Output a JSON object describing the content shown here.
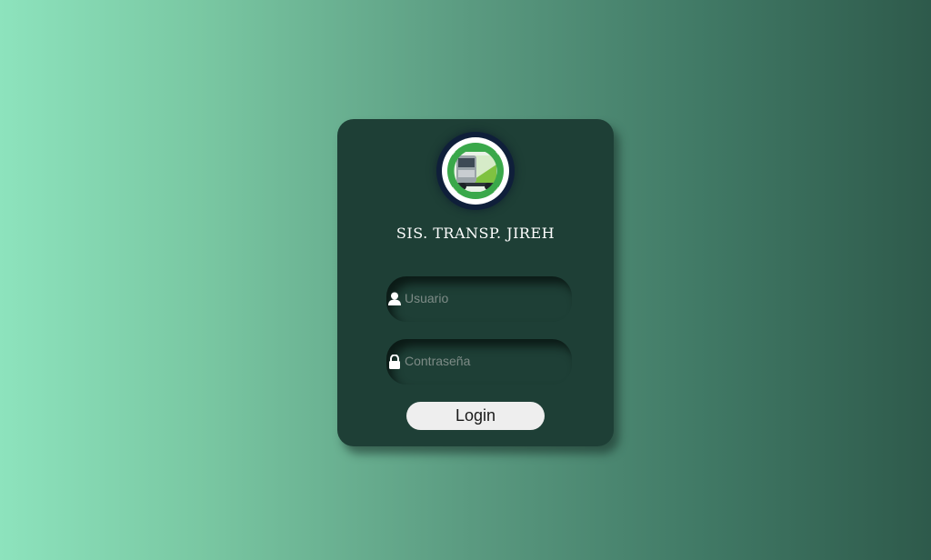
{
  "login": {
    "brand_title": "SIS. TRANSP. JIREH",
    "username": {
      "placeholder": "Usuario",
      "value": "",
      "icon": "user-icon"
    },
    "password": {
      "placeholder": "Contraseña",
      "value": "",
      "icon": "lock-icon"
    },
    "submit_label": "Login",
    "logo": "truck-logo"
  },
  "colors": {
    "card_background": "#1e3f36",
    "page_gradient_start": "#8de3bd",
    "page_gradient_end": "#2e5a4b",
    "logo_green": "#3aa84a",
    "button_background": "#eeeeee"
  }
}
